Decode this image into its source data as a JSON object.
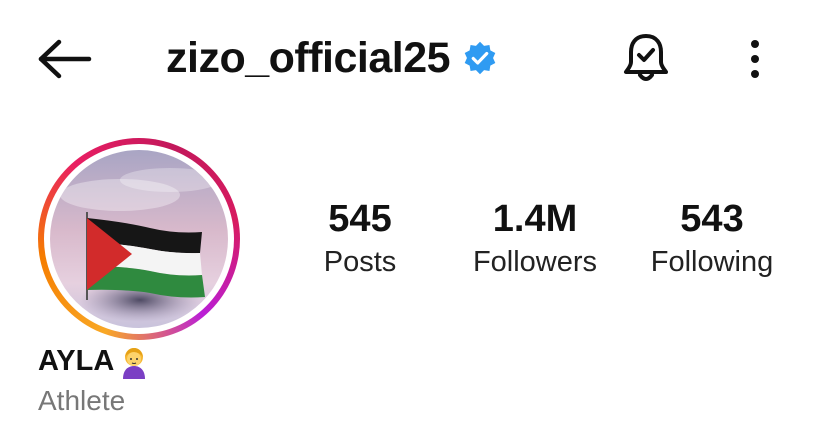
{
  "header": {
    "back_icon": "arrow-left-icon",
    "username": "zizo_official25",
    "verified_icon": "verified-badge-icon",
    "verified_color": "#2f9bf2",
    "notification_icon": "bell-icon",
    "more_icon": "more-vertical-icon"
  },
  "profile": {
    "avatar_ring_colors": [
      "#f9a825",
      "#e91e63",
      "#ba1fd6"
    ],
    "display_name": "AYLA",
    "display_name_emoji": "🙎‍♀️",
    "category": "Athlete"
  },
  "stats": {
    "posts": {
      "value": "545",
      "label": "Posts"
    },
    "followers": {
      "value": "1.4M",
      "label": "Followers"
    },
    "following": {
      "value": "543",
      "label": "Following"
    }
  }
}
